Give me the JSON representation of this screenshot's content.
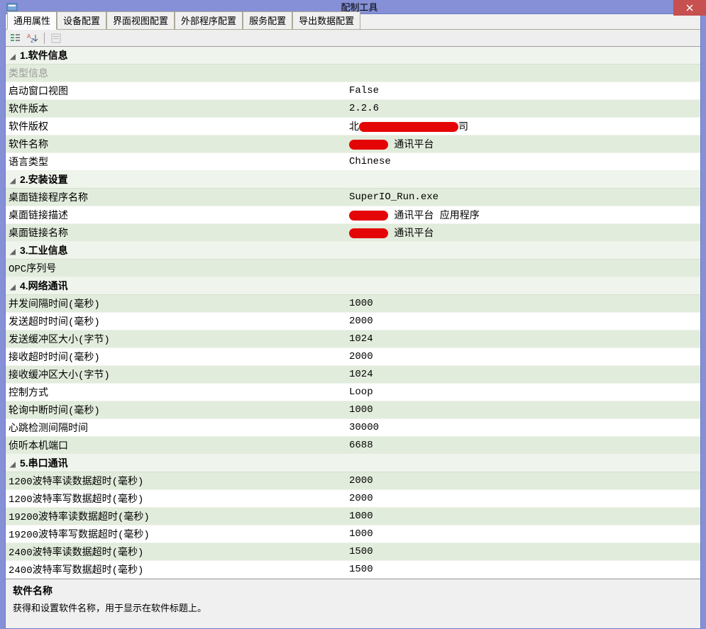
{
  "window": {
    "title": "配制工具"
  },
  "tabs": [
    {
      "label": "通用属性",
      "active": true
    },
    {
      "label": "设备配置",
      "active": false
    },
    {
      "label": "界面视图配置",
      "active": false
    },
    {
      "label": "外部程序配置",
      "active": false
    },
    {
      "label": "服务配置",
      "active": false
    },
    {
      "label": "导出数据配置",
      "active": false
    }
  ],
  "toolbar_icons": [
    "categorized-icon",
    "alphabetical-icon",
    "property-pages-icon"
  ],
  "categories": [
    {
      "title": "1.软件信息",
      "rows": [
        {
          "label": "类型信息",
          "value": "",
          "disabled": true
        },
        {
          "label": "启动窗口视图",
          "value": "False"
        },
        {
          "label": "软件版本",
          "value": "2.2.6"
        },
        {
          "label": "软件版权",
          "value": "北",
          "redacted_mid": true,
          "value_suffix": "司"
        },
        {
          "label": "软件名称",
          "value": "",
          "redacted_prefix": true,
          "value_suffix": " 通讯平台"
        },
        {
          "label": "语言类型",
          "value": "Chinese"
        }
      ]
    },
    {
      "title": "2.安装设置",
      "rows": [
        {
          "label": "桌面链接程序名称",
          "value": "SuperIO_Run.exe"
        },
        {
          "label": "桌面链接描述",
          "value": "",
          "redacted_prefix": true,
          "value_suffix": " 通讯平台 应用程序"
        },
        {
          "label": "桌面链接名称",
          "value": "",
          "redacted_prefix": true,
          "value_suffix": " 通讯平台"
        }
      ]
    },
    {
      "title": "3.工业信息",
      "rows": [
        {
          "label": "OPC序列号",
          "value": ""
        }
      ]
    },
    {
      "title": "4.网络通讯",
      "rows": [
        {
          "label": "并发间隔时间(毫秒)",
          "value": "1000"
        },
        {
          "label": "发送超时时间(毫秒)",
          "value": "2000"
        },
        {
          "label": "发送缓冲区大小(字节)",
          "value": "1024"
        },
        {
          "label": "接收超时时间(毫秒)",
          "value": "2000"
        },
        {
          "label": "接收缓冲区大小(字节)",
          "value": "1024"
        },
        {
          "label": "控制方式",
          "value": "Loop"
        },
        {
          "label": "轮询中断时间(毫秒)",
          "value": "1000"
        },
        {
          "label": "心跳检测间隔时间",
          "value": "30000"
        },
        {
          "label": "侦听本机端口",
          "value": "6688"
        }
      ]
    },
    {
      "title": "5.串口通讯",
      "rows": [
        {
          "label": "1200波特率读数据超时(毫秒)",
          "value": "2000"
        },
        {
          "label": "1200波特率写数据超时(毫秒)",
          "value": "2000"
        },
        {
          "label": "19200波特率读数据超时(毫秒)",
          "value": "1000"
        },
        {
          "label": "19200波特率写数据超时(毫秒)",
          "value": "1000"
        },
        {
          "label": "2400波特率读数据超时(毫秒)",
          "value": "1500"
        },
        {
          "label": "2400波特率写数据超时(毫秒)",
          "value": "1500"
        }
      ]
    }
  ],
  "help": {
    "title": "软件名称",
    "desc": "获得和设置软件名称，用于显示在软件标题上。"
  }
}
